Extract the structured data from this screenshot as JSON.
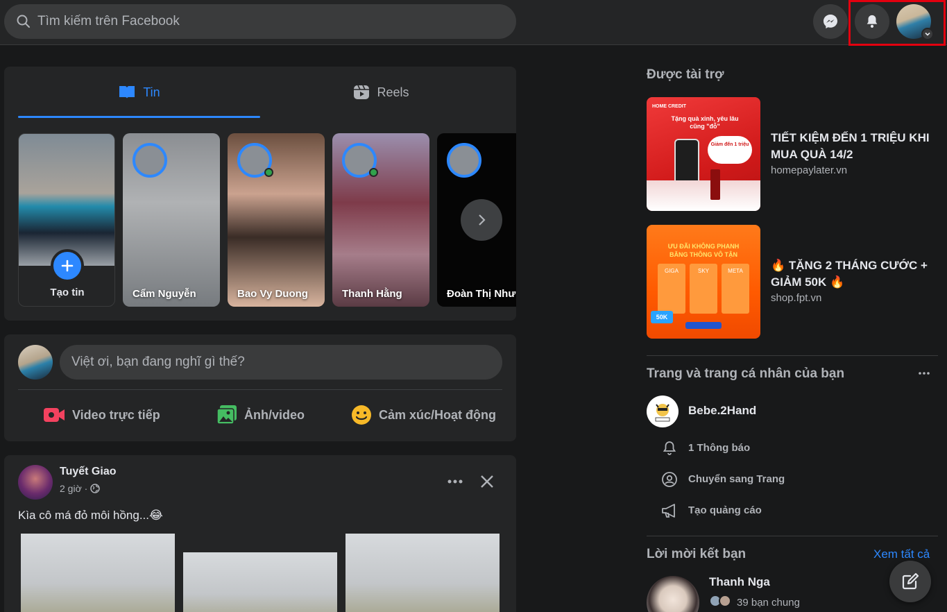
{
  "search": {
    "placeholder": "Tìm kiếm trên Facebook"
  },
  "tabs": {
    "stories_label": "Tin",
    "reels_label": "Reels"
  },
  "stories": {
    "create_label": "Tạo tin",
    "items": [
      {
        "name": "Cẩm Nguyễn",
        "online": false
      },
      {
        "name": "Bao Vy Duong",
        "online": true
      },
      {
        "name": "Thanh Hằng",
        "online": true
      },
      {
        "name": "Đoàn Thị Như Ý",
        "online": false
      }
    ]
  },
  "composer": {
    "placeholder": "Việt ơi, bạn đang nghĩ gì thế?",
    "live_label": "Video trực tiếp",
    "photo_label": "Ảnh/video",
    "feeling_label": "Cảm xúc/Hoạt động"
  },
  "post": {
    "author": "Tuyết Giao",
    "time": "2 giờ ·",
    "text": "Kìa cô má đỏ môi hồng...😂"
  },
  "sponsored": {
    "heading": "Được tài trợ",
    "ads": [
      {
        "title": "TIẾT KIỆM ĐẾN 1 TRIỆU KHI MUA QUÀ 14/2",
        "domain": "homepaylater.vn",
        "image_lines": [
          "HOME CREDIT",
          "Tặng quà xinh, yêu lâu cũng \"đỗ\"",
          "Giảm đến 1 triệu"
        ]
      },
      {
        "title": "🔥 TẶNG 2 THÁNG CƯỚC + GIẢM 50K 🔥",
        "domain": "shop.fpt.vn",
        "image_lines": [
          "ƯU ĐÃI KHÔNG PHANH",
          "BĂNG THÔNG VÔ TẬN",
          "GIGA",
          "SKY",
          "META",
          "50K"
        ]
      }
    ]
  },
  "pages": {
    "heading": "Trang và trang cá nhân của bạn",
    "page_name": "Bebe.2Hand",
    "items": [
      "1 Thông báo",
      "Chuyển sang Trang",
      "Tạo quảng cáo"
    ]
  },
  "friend_requests": {
    "heading": "Lời mời kết bạn",
    "see_all": "Xem tất cả",
    "items": [
      {
        "name": "Thanh Nga",
        "mutual": "39 bạn chung"
      }
    ]
  },
  "colors": {
    "accent": "#2d88ff",
    "highlight": "#e3000f",
    "background": "#18191a",
    "card": "#242526"
  }
}
